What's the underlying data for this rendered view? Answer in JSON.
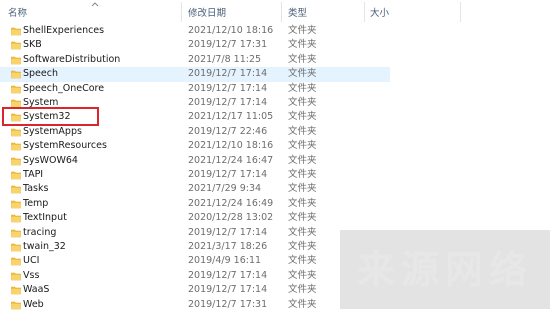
{
  "header": {
    "name": "名称",
    "date": "修改日期",
    "type": "类型",
    "size": "大小"
  },
  "rows": [
    {
      "name": "ShellExperiences",
      "date": "2021/12/10 18:16",
      "type": "文件夹"
    },
    {
      "name": "SKB",
      "date": "2019/12/7 17:31",
      "type": "文件夹"
    },
    {
      "name": "SoftwareDistribution",
      "date": "2021/7/8 11:25",
      "type": "文件夹"
    },
    {
      "name": "Speech",
      "date": "2019/12/7 17:14",
      "type": "文件夹",
      "selected": true
    },
    {
      "name": "Speech_OneCore",
      "date": "2019/12/7 17:14",
      "type": "文件夹"
    },
    {
      "name": "System",
      "date": "2019/12/7 17:14",
      "type": "文件夹"
    },
    {
      "name": "System32",
      "date": "2021/12/17 11:05",
      "type": "文件夹"
    },
    {
      "name": "SystemApps",
      "date": "2019/12/7 22:46",
      "type": "文件夹"
    },
    {
      "name": "SystemResources",
      "date": "2021/12/10 18:16",
      "type": "文件夹"
    },
    {
      "name": "SysWOW64",
      "date": "2021/12/24 16:47",
      "type": "文件夹"
    },
    {
      "name": "TAPI",
      "date": "2019/12/7 17:14",
      "type": "文件夹"
    },
    {
      "name": "Tasks",
      "date": "2021/7/29 9:34",
      "type": "文件夹"
    },
    {
      "name": "Temp",
      "date": "2021/12/24 16:49",
      "type": "文件夹"
    },
    {
      "name": "TextInput",
      "date": "2020/12/28 13:02",
      "type": "文件夹"
    },
    {
      "name": "tracing",
      "date": "2019/12/7 17:14",
      "type": "文件夹"
    },
    {
      "name": "twain_32",
      "date": "2021/3/17 18:26",
      "type": "文件夹"
    },
    {
      "name": "UCI",
      "date": "2019/4/9 16:11",
      "type": "文件夹"
    },
    {
      "name": "Vss",
      "date": "2019/12/7 17:14",
      "type": "文件夹"
    },
    {
      "name": "WaaS",
      "date": "2019/12/7 17:14",
      "type": "文件夹"
    },
    {
      "name": "Web",
      "date": "2019/12/7 17:31",
      "type": "文件夹"
    }
  ],
  "watermark": "来源网络",
  "colors": {
    "selected_bg": "#e5f3ff",
    "highlight_border": "#d9262a",
    "folder_fill": "#f5c342",
    "header_text": "#4c607a"
  },
  "icons": {
    "folder": "folder-icon",
    "sort": "sort-up-arrow-icon"
  }
}
